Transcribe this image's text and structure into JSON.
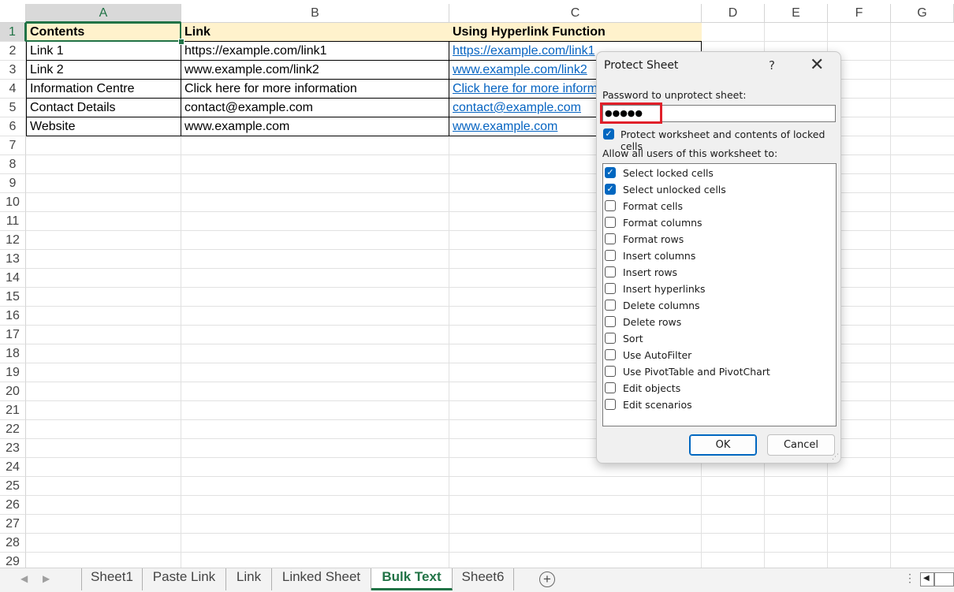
{
  "columns": [
    "A",
    "B",
    "C",
    "D",
    "E",
    "F",
    "G"
  ],
  "rows": [
    "1",
    "2",
    "3",
    "4",
    "5",
    "6",
    "7",
    "8",
    "9",
    "10",
    "11",
    "12",
    "13",
    "14",
    "15",
    "16",
    "17",
    "18",
    "19",
    "20",
    "21",
    "22",
    "23",
    "24",
    "25",
    "26",
    "27",
    "28",
    "29"
  ],
  "table": {
    "headers": [
      "Contents",
      "Link",
      "Using Hyperlink Function"
    ],
    "rows": [
      [
        "Link 1",
        "https://example.com/link1",
        "https://example.com/link1"
      ],
      [
        "Link 2",
        "www.example.com/link2",
        "www.example.com/link2"
      ],
      [
        "Information Centre",
        "Click here for more information",
        "Click here for more information"
      ],
      [
        "Contact Details",
        "contact@example.com",
        "contact@example.com"
      ],
      [
        "Website",
        "www.example.com",
        "www.example.com"
      ]
    ]
  },
  "tabs": [
    "Sheet1",
    "Paste Link",
    "Link",
    "Linked Sheet",
    "Bulk Text",
    "Sheet6"
  ],
  "active_tab": "Bulk Text",
  "dialog": {
    "title": "Protect Sheet",
    "help": "?",
    "close": "✕",
    "password_label": "Password to unprotect sheet:",
    "password_value": "●●●●●",
    "protect_label": "Protect worksheet and contents of locked cells",
    "protect_checked": true,
    "allow_label": "Allow all users of this worksheet to:",
    "permissions": [
      {
        "label": "Select locked cells",
        "checked": true
      },
      {
        "label": "Select unlocked cells",
        "checked": true
      },
      {
        "label": "Format cells",
        "checked": false
      },
      {
        "label": "Format columns",
        "checked": false
      },
      {
        "label": "Format rows",
        "checked": false
      },
      {
        "label": "Insert columns",
        "checked": false
      },
      {
        "label": "Insert rows",
        "checked": false
      },
      {
        "label": "Insert hyperlinks",
        "checked": false
      },
      {
        "label": "Delete columns",
        "checked": false
      },
      {
        "label": "Delete rows",
        "checked": false
      },
      {
        "label": "Sort",
        "checked": false
      },
      {
        "label": "Use AutoFilter",
        "checked": false
      },
      {
        "label": "Use PivotTable and PivotChart",
        "checked": false
      },
      {
        "label": "Edit objects",
        "checked": false
      },
      {
        "label": "Edit scenarios",
        "checked": false
      }
    ],
    "ok_label": "OK",
    "cancel_label": "Cancel"
  },
  "colors": {
    "accent": "#217346",
    "link": "#0563c1",
    "header_fill": "#fff2cc",
    "highlight": "#e0202a",
    "checkbox": "#0067c0"
  }
}
